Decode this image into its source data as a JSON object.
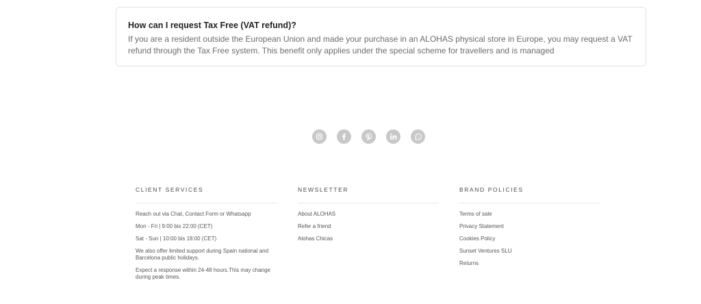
{
  "faq": {
    "question": "How can I request Tax Free (VAT refund)?",
    "answer": "If you are a resident outside the European Union and made your purchase in an ALOHAS physical store in Europe, you may request a VAT refund through the Tax Free system. This benefit only applies under the special scheme for travellers and is managed"
  },
  "social": {
    "color": "#c8c8c8",
    "icons": [
      "instagram-icon",
      "facebook-icon",
      "pinterest-icon",
      "linkedin-icon",
      "whatsapp-icon"
    ]
  },
  "footer": {
    "client_services": {
      "heading": "CLIENT SERVICES",
      "items": [
        "Reach out via Chat, Contact Form or Whatsapp",
        "Mon - Fri | 9:00 bis 22:00 (CET)",
        "Sat - Sun | 10:00 bis 18:00 (CET)",
        "We also offer limited support during Spain national and Barcelona public holidays.",
        "Expect a response within 24-48 hours.This may change during peak times."
      ]
    },
    "newsletter": {
      "heading": "NEWSLETTER",
      "items": [
        "About ALOHAS",
        "Refer a friend",
        "Alohas Chicas"
      ]
    },
    "brand_policies": {
      "heading": "BRAND POLICIES",
      "items": [
        "Terms of sale",
        "Privacy Statement",
        "Cookies Policy",
        "Sunset Ventures SLU",
        "Returns"
      ]
    }
  }
}
